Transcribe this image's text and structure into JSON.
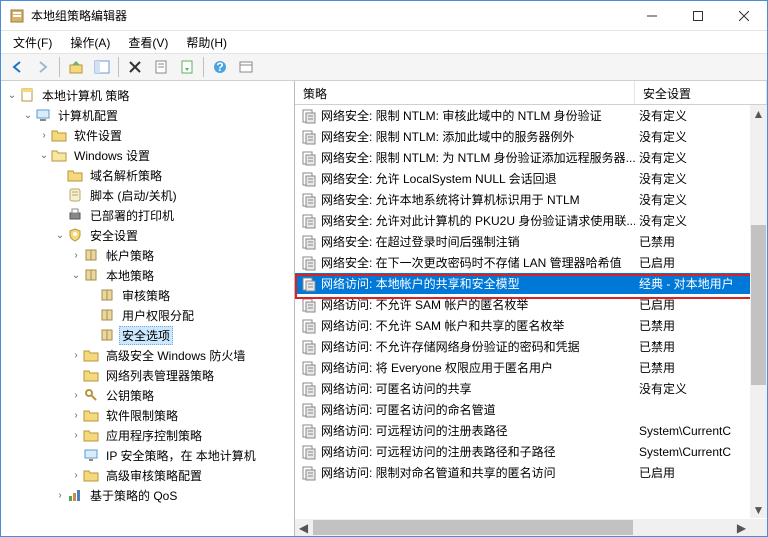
{
  "window": {
    "title": "本地组策略编辑器"
  },
  "menu": {
    "file": "文件(F)",
    "action": "操作(A)",
    "view": "查看(V)",
    "help": "帮助(H)"
  },
  "header": {
    "policy": "策略",
    "setting": "安全设置"
  },
  "tree": {
    "root": "本地计算机 策略",
    "computer_cfg": "计算机配置",
    "software": "软件设置",
    "windows": "Windows 设置",
    "dns": "域名解析策略",
    "script": "脚本 (启动/关机)",
    "printers": "已部署的打印机",
    "security": "安全设置",
    "account": "帐户策略",
    "local": "本地策略",
    "audit": "审核策略",
    "rights": "用户权限分配",
    "options": "安全选项",
    "firewall": "高级安全 Windows 防火墙",
    "netlist": "网络列表管理器策略",
    "pubkey": "公钥策略",
    "softrest": "软件限制策略",
    "appctrl": "应用程序控制策略",
    "ipsec": "IP 安全策略，在 本地计算机",
    "adv_audit": "高级审核策略配置",
    "qos": "基于策略的 QoS"
  },
  "policies": [
    {
      "name": "网络安全: 限制 NTLM: 审核此域中的 NTLM 身份验证",
      "setting": "没有定义"
    },
    {
      "name": "网络安全: 限制 NTLM: 添加此域中的服务器例外",
      "setting": "没有定义"
    },
    {
      "name": "网络安全: 限制 NTLM: 为 NTLM 身份验证添加远程服务器...",
      "setting": "没有定义"
    },
    {
      "name": "网络安全: 允许 LocalSystem NULL 会话回退",
      "setting": "没有定义"
    },
    {
      "name": "网络安全: 允许本地系统将计算机标识用于 NTLM",
      "setting": "没有定义"
    },
    {
      "name": "网络安全: 允许对此计算机的 PKU2U 身份验证请求使用联...",
      "setting": "没有定义"
    },
    {
      "name": "网络安全: 在超过登录时间后强制注销",
      "setting": "已禁用"
    },
    {
      "name": "网络安全: 在下一次更改密码时不存储 LAN 管理器哈希值",
      "setting": "已启用"
    },
    {
      "name": "网络访问: 本地帐户的共享和安全模型",
      "setting": "经典 - 对本地用户",
      "selected": true
    },
    {
      "name": "网络访问: 不允许 SAM 帐户的匿名枚举",
      "setting": "已启用"
    },
    {
      "name": "网络访问: 不允许 SAM 帐户和共享的匿名枚举",
      "setting": "已禁用"
    },
    {
      "name": "网络访问: 不允许存储网络身份验证的密码和凭据",
      "setting": "已禁用"
    },
    {
      "name": "网络访问: 将 Everyone 权限应用于匿名用户",
      "setting": "已禁用"
    },
    {
      "name": "网络访问: 可匿名访问的共享",
      "setting": "没有定义"
    },
    {
      "name": "网络访问: 可匿名访问的命名管道",
      "setting": ""
    },
    {
      "name": "网络访问: 可远程访问的注册表路径",
      "setting": "System\\CurrentC"
    },
    {
      "name": "网络访问: 可远程访问的注册表路径和子路径",
      "setting": "System\\CurrentC"
    },
    {
      "name": "网络访问: 限制对命名管道和共享的匿名访问",
      "setting": "已启用"
    }
  ]
}
